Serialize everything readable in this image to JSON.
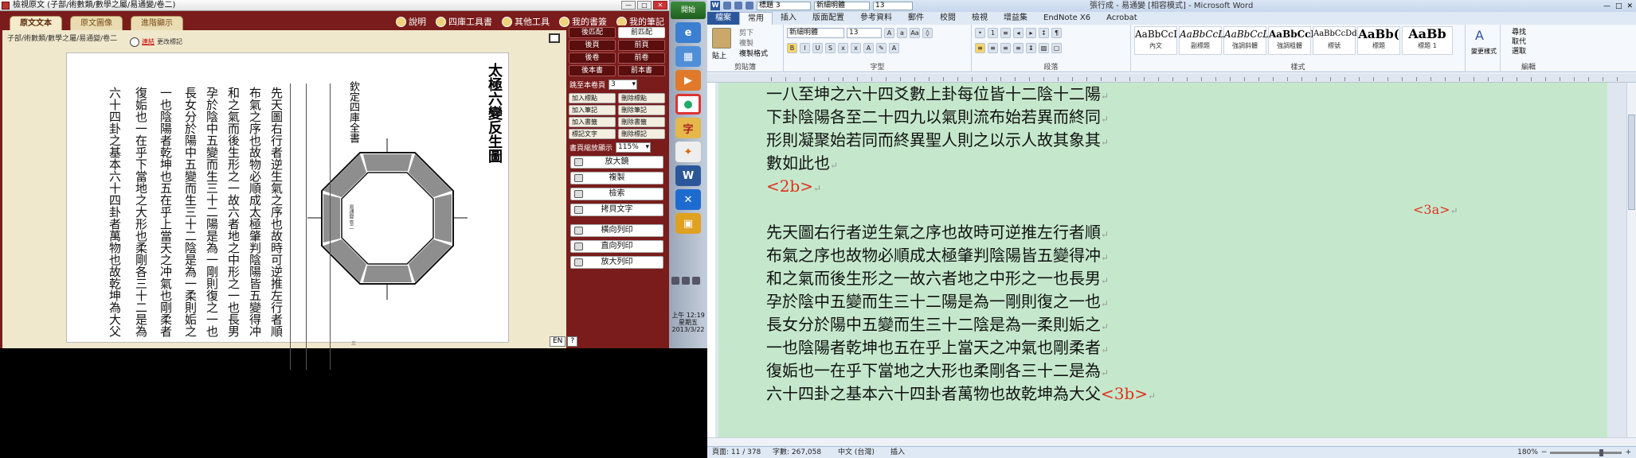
{
  "viewer": {
    "title": "檢視原文 (子部/術數類/數學之屬/易通變/卷二)",
    "tabs": [
      "原文文本",
      "原文圖像",
      "進階顯示"
    ],
    "links": [
      "說明",
      "四庫工具書",
      "其他工具",
      "我的書簽",
      "我的筆記"
    ],
    "breadcrumb": "子部/術數類/數學之屬/易通變/卷二",
    "tool_label": "連結",
    "tool_text": "更改標記",
    "page": {
      "figure_title": "太極六變反生圖",
      "side_label": "欽定四庫全書",
      "small_label": "易通變 卷二",
      "page_no": "三",
      "columns": [
        "先天圖右行者逆生氣之序也故時可逆推左行者順",
        "布氣之序也故物必順成太極肇判陰陽皆五變得冲",
        "和之氣而後生形之一故六者地之中形之一也長男",
        "孕於陰中五變而生三十二陽是為一剛則復之一也",
        "長女分於陽中五變而生三十二陰是為一柔則姤之",
        "一也陰陽者乾坤也五在乎上當天之冲氣也剛柔者",
        "復姤也一在乎下當地之大形也柔剛各三十二是為",
        "六十四卦之基本六十四卦者萬物也故乾坤為大父"
      ]
    },
    "side": {
      "nav": [
        [
          "後匹配",
          "前匹配"
        ],
        [
          "後頁",
          "前頁"
        ],
        [
          "後卷",
          "前卷"
        ],
        [
          "後本書",
          "前本書"
        ]
      ],
      "jump_label": "跳至本卷頁",
      "jump_value": "3",
      "marks": [
        [
          "加入標點",
          "刪除標點"
        ],
        [
          "加入筆記",
          "刪除筆記"
        ],
        [
          "加入書籤",
          "刪除書籤"
        ],
        [
          "標記文字",
          "刪除標記"
        ]
      ],
      "zoom_label": "書頁縮放顯示",
      "zoom_value": "115%",
      "actions": [
        "放大鏡",
        "複製",
        "檢索",
        "拷貝文字",
        "橫向列印",
        "直向列印",
        "放大列印"
      ]
    },
    "status": [
      "EN",
      "?"
    ]
  },
  "launcher": {
    "start": "開始",
    "clock": [
      "上午 12:19",
      "星期五",
      "2013/3/22"
    ]
  },
  "word": {
    "title_style": "標題 3",
    "title_font": "新細明體",
    "title_size": "13",
    "doc_title": "張行成 - 易通變 [相容模式] - Microsoft Word",
    "tabs": [
      "檔案",
      "常用",
      "插入",
      "版面配置",
      "參考資料",
      "郵件",
      "校閱",
      "檢視",
      "增益集",
      "EndNote X6",
      "Acrobat"
    ],
    "ribbon": {
      "paste": "貼上",
      "cut": "剪下",
      "copy": "複製",
      "format_painter": "複製格式",
      "font_name": "新細明體",
      "font_size": "13",
      "groups": [
        "剪貼簿",
        "字型",
        "段落",
        "樣式",
        "編輯"
      ],
      "styles": [
        {
          "sample": "AaBbCcI",
          "name": "內文"
        },
        {
          "sample": "AaBbCcL",
          "name": "副標題"
        },
        {
          "sample": "AaBbCcL",
          "name": "強調斜體"
        },
        {
          "sample": "AaBbCcI",
          "name": "強調粗體"
        },
        {
          "sample": "AaBbCcDd",
          "name": "標號"
        },
        {
          "sample": "AaBb(",
          "name": "標題"
        },
        {
          "sample": "AaBb",
          "name": "標題 1"
        }
      ],
      "change_styles": "變更樣式",
      "find": "尋找",
      "replace": "取代",
      "select": "選取"
    },
    "doc_lines": [
      "一八至坤之六十四爻數上卦每位皆十二陰十二陽",
      "下卦陰陽各至二十四九以氣則流布始若異而終同",
      "形則凝聚始若同而終異聖人則之以示人故其象其",
      "數如此也",
      "<2b>",
      "先天圖右行者逆生氣之序也故時可逆推左行者順",
      "布氣之序也故物必順成太極肇判陰陽皆五變得冲",
      "和之氣而後生形之一故六者地之中形之一也長男",
      "孕於陰中五變而生三十二陽是為一剛則復之一也",
      "長女分於陽中五變而生三十二陰是為一柔則姤之",
      "一也陰陽者乾坤也五在乎上當天之冲氣也剛柔者",
      "復姤也一在乎下當地之大形也柔剛各三十二是為",
      "六十四卦之基本六十四卦者萬物也故乾坤為大父"
    ],
    "marker_3a": "<3a>",
    "marker_3b": "<3b>",
    "status": {
      "page": "頁面: 11 / 378",
      "words": "字數: 267,058",
      "lang": "中文 (台灣)",
      "mode": "插入",
      "zoom": "180%"
    }
  },
  "colors": {
    "viewer_bg": "#7a1c1c",
    "page_green": "#c5e8cc",
    "marker_red": "#e03020",
    "ribbon_blue": "#2b579a"
  }
}
